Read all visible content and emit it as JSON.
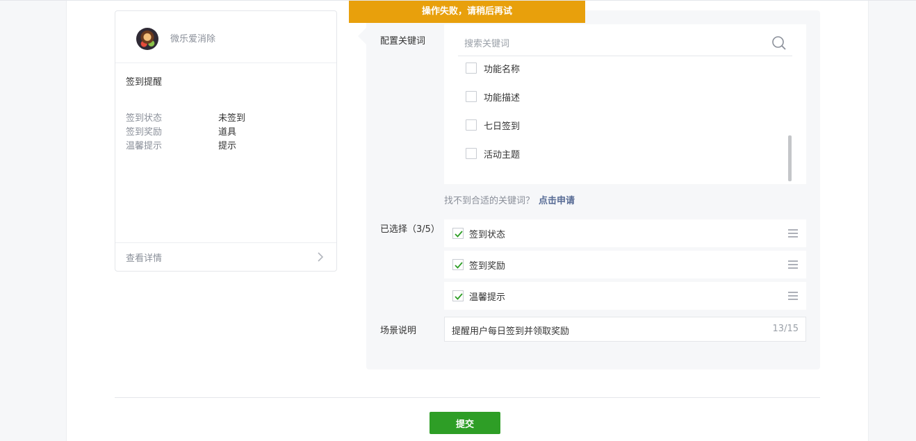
{
  "toast": {
    "message": "操作失败，请稍后再试"
  },
  "preview": {
    "app_name": "微乐爱消除",
    "title": "签到提醒",
    "fields": [
      {
        "key": "签到状态",
        "value": "未签到"
      },
      {
        "key": "签到奖励",
        "value": "道具"
      },
      {
        "key": "温馨提示",
        "value": "提示"
      }
    ],
    "detail_label": "查看详情"
  },
  "config": {
    "keyword_label": "配置关键词",
    "search_placeholder": "搜索关键词",
    "keywords": [
      "功能名称",
      "功能描述",
      "七日签到",
      "活动主题"
    ],
    "hint_text": "找不到合适的关键词？",
    "hint_link": "点击申请",
    "selected_label": "已选择（3/5）",
    "selected": [
      "签到状态",
      "签到奖励",
      "温馨提示"
    ],
    "scene_label": "场景说明",
    "scene_value": "提醒用户每日签到并领取奖励",
    "scene_count": "13/15"
  },
  "actions": {
    "submit_label": "提交"
  },
  "colors": {
    "accent": "#2e9e26",
    "toast": "#e8a00c",
    "link": "#576b95"
  }
}
